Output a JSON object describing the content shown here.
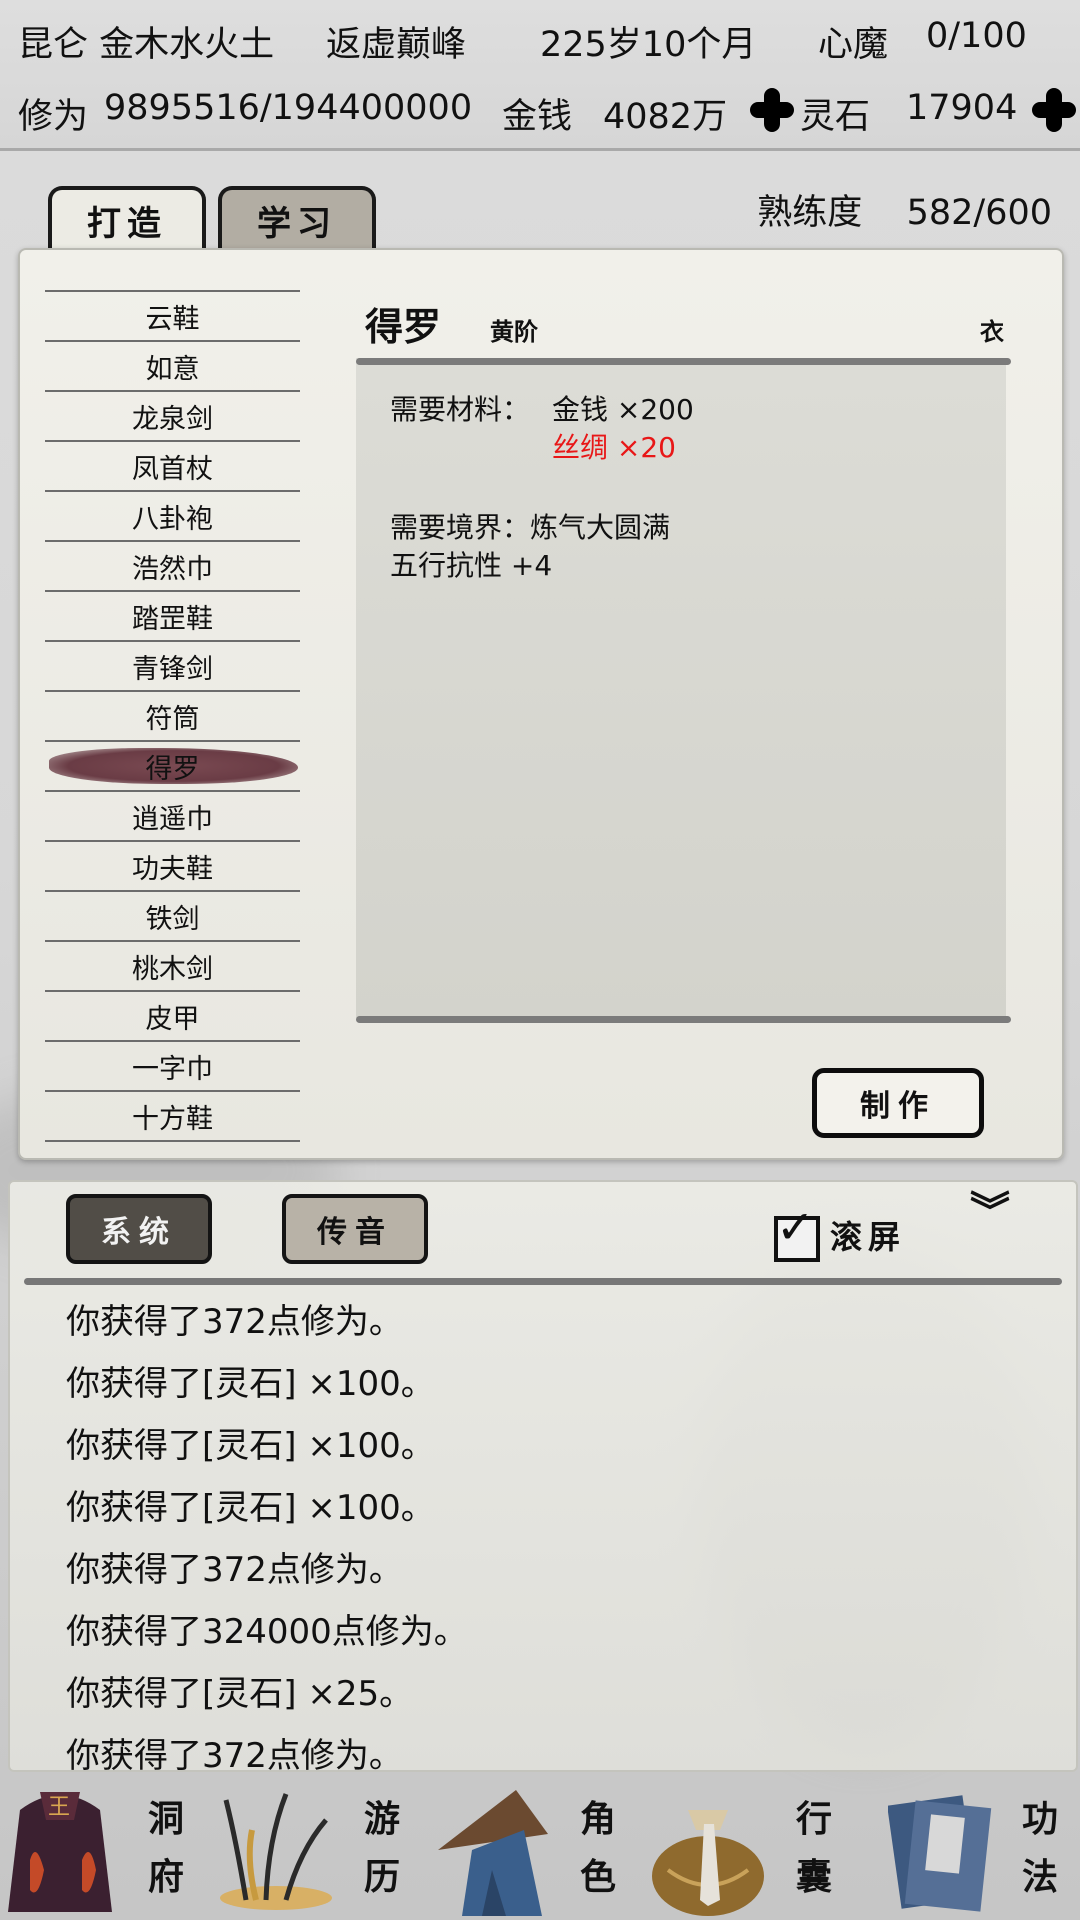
{
  "status": {
    "sect": "昆仑 金木水火土",
    "realm": "返虚巅峰",
    "age": "225岁10个月",
    "heart_demon_label": "心魔",
    "heart_demon_value": "0/100",
    "cultivation_label": "修为",
    "cultivation_value": "9895516/194400000",
    "money_label": "金钱",
    "money_value": "4082万",
    "spirit_stone_label": "灵石",
    "spirit_stone_value": "17904"
  },
  "tabs": {
    "craft": "打造",
    "learn": "学习"
  },
  "proficiency": {
    "label": "熟练度",
    "value": "582/600"
  },
  "recipes": [
    "云鞋",
    "如意",
    "龙泉剑",
    "凤首杖",
    "八卦袍",
    "浩然巾",
    "踏罡鞋",
    "青锋剑",
    "符筒",
    "得罗",
    "逍遥巾",
    "功夫鞋",
    "铁剑",
    "桃木剑",
    "皮甲",
    "一字巾",
    "十方鞋"
  ],
  "selected_recipe": "得罗",
  "detail": {
    "name": "得罗",
    "grade": "黄阶",
    "type": "衣",
    "materials_label": "需要材料：",
    "material1": "金钱 ×200",
    "material2": "丝绸 ×20",
    "realm_req": "需要境界：炼气大圆满",
    "effect": "五行抗性 +4"
  },
  "make_button": "制作",
  "chat": {
    "tab_system": "系统",
    "tab_voice": "传音",
    "scroll_label": "滚屏",
    "log": [
      "你获得了372点修为。",
      "你获得了[灵石] ×100。",
      "你获得了[灵石] ×100。",
      "你获得了[灵石] ×100。",
      "你获得了372点修为。",
      "你获得了324000点修为。",
      "你获得了[灵石] ×25。",
      "你获得了372点修为。"
    ]
  },
  "nav": [
    {
      "l1": "洞",
      "l2": "府"
    },
    {
      "l1": "游",
      "l2": "历"
    },
    {
      "l1": "角",
      "l2": "色"
    },
    {
      "l1": "行",
      "l2": "囊"
    },
    {
      "l1": "功",
      "l2": "法"
    }
  ]
}
